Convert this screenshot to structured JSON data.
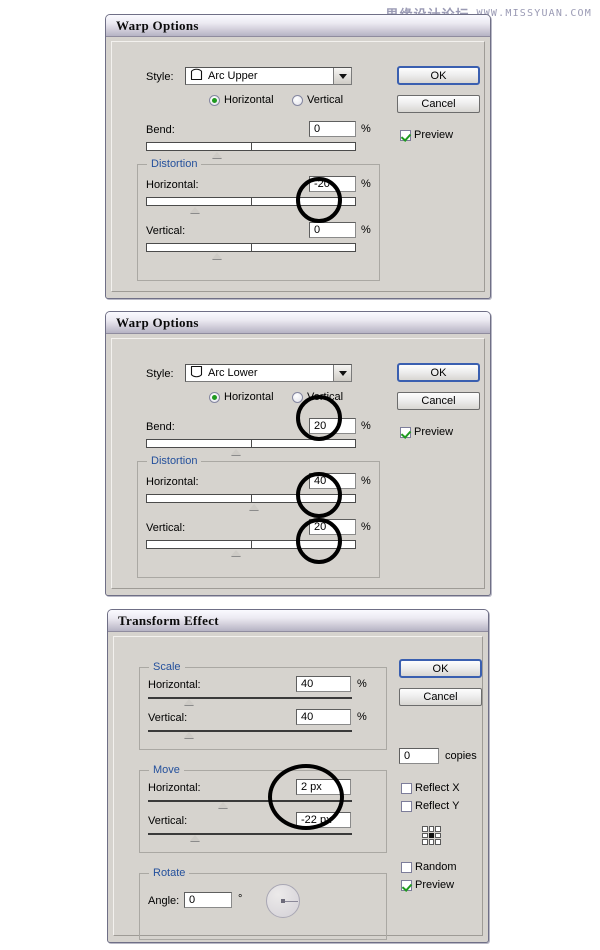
{
  "watermark": {
    "cn": "思缘设计论坛",
    "en": "WWW.MISSYUAN.COM"
  },
  "dialogs": [
    {
      "title": "Warp Options",
      "style_label": "Style:",
      "style_value": "Arc Upper",
      "style_icon": "arc-upper-icon",
      "orientation": {
        "horizontal": "Horizontal",
        "vertical": "Vertical",
        "selected": "Horizontal"
      },
      "bend_label": "Bend:",
      "bend_value": "0",
      "bend_unit": "%",
      "distortion_label": "Distortion",
      "dist_h_label": "Horizontal:",
      "dist_h_value": "-20",
      "dist_h_unit": "%",
      "dist_v_label": "Vertical:",
      "dist_v_value": "0",
      "dist_v_unit": "%",
      "ok_label": "OK",
      "cancel_label": "Cancel",
      "preview_label": "Preview",
      "preview_checked": true
    },
    {
      "title": "Warp Options",
      "style_label": "Style:",
      "style_value": "Arc Lower",
      "style_icon": "arc-lower-icon",
      "orientation": {
        "horizontal": "Horizontal",
        "vertical": "Vertical",
        "selected": "Horizontal"
      },
      "bend_label": "Bend:",
      "bend_value": "20",
      "bend_unit": "%",
      "distortion_label": "Distortion",
      "dist_h_label": "Horizontal:",
      "dist_h_value": "40",
      "dist_h_unit": "%",
      "dist_v_label": "Vertical:",
      "dist_v_value": "20",
      "dist_v_unit": "%",
      "ok_label": "OK",
      "cancel_label": "Cancel",
      "preview_label": "Preview",
      "preview_checked": true
    }
  ],
  "transform": {
    "title": "Transform Effect",
    "scale_label": "Scale",
    "scale_h_label": "Horizontal:",
    "scale_h_value": "40",
    "scale_h_unit": "%",
    "scale_v_label": "Vertical:",
    "scale_v_value": "40",
    "scale_v_unit": "%",
    "move_label": "Move",
    "move_h_label": "Horizontal:",
    "move_h_value": "2 px",
    "move_v_label": "Vertical:",
    "move_v_value": "-22 px",
    "rotate_label": "Rotate",
    "angle_label": "Angle:",
    "angle_value": "0",
    "angle_unit": "°",
    "ok_label": "OK",
    "cancel_label": "Cancel",
    "copies_value": "0",
    "copies_label": "copies",
    "reflect_x_label": "Reflect X",
    "reflect_x_checked": false,
    "reflect_y_label": "Reflect Y",
    "reflect_y_checked": false,
    "random_label": "Random",
    "random_checked": false,
    "preview_label": "Preview",
    "preview_checked": true,
    "reference_point": "center"
  }
}
